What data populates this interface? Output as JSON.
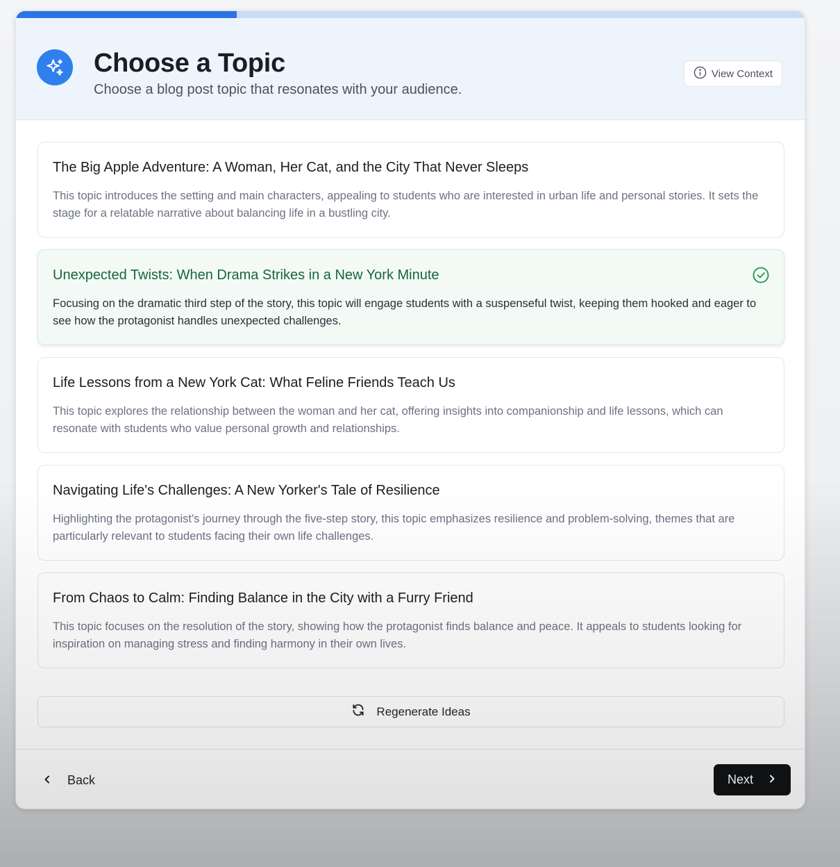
{
  "progress": {
    "fraction": 0.28,
    "fill_color": "#2c74e6",
    "track_color": "#c9dcf6"
  },
  "header": {
    "icon": "sparkle-icon",
    "title": "Choose a Topic",
    "subtitle": "Choose a blog post topic that resonates with your audience.",
    "view_context_icon": "info-icon",
    "view_context_label": "View Context"
  },
  "topics": [
    {
      "title": "The Big Apple Adventure: A Woman, Her Cat, and the City That Never Sleeps",
      "description": "This topic introduces the setting and main characters, appealing to students who are interested in urban life and personal stories. It sets the stage for a relatable narrative about balancing life in a bustling city.",
      "selected": false
    },
    {
      "title": "Unexpected Twists: When Drama Strikes in a New York Minute",
      "description": "Focusing on the dramatic third step of the story, this topic will engage students with a suspenseful twist, keeping them hooked and eager to see how the protagonist handles unexpected challenges.",
      "selected": true
    },
    {
      "title": "Life Lessons from a New York Cat: What Feline Friends Teach Us",
      "description": "This topic explores the relationship between the woman and her cat, offering insights into companionship and life lessons, which can resonate with students who value personal growth and relationships.",
      "selected": false
    },
    {
      "title": "Navigating Life's Challenges: A New Yorker's Tale of Resilience",
      "description": "Highlighting the protagonist's journey through the five-step story, this topic emphasizes resilience and problem-solving, themes that are particularly relevant to students facing their own life challenges.",
      "selected": false
    },
    {
      "title": "From Chaos to Calm: Finding Balance in the City with a Furry Friend",
      "description": "This topic focuses on the resolution of the story, showing how the protagonist finds balance and peace. It appeals to students looking for inspiration on managing stress and finding harmony in their own lives.",
      "selected": false
    }
  ],
  "regenerate": {
    "icon": "refresh-icon",
    "label": "Regenerate Ideas"
  },
  "footer": {
    "back_icon": "chevron-left-icon",
    "back_label": "Back",
    "next_label": "Next",
    "next_icon": "chevron-right-icon"
  },
  "colors": {
    "accent": "#2f80ed",
    "selected_text": "#17653d",
    "check": "#2e9e5b"
  }
}
